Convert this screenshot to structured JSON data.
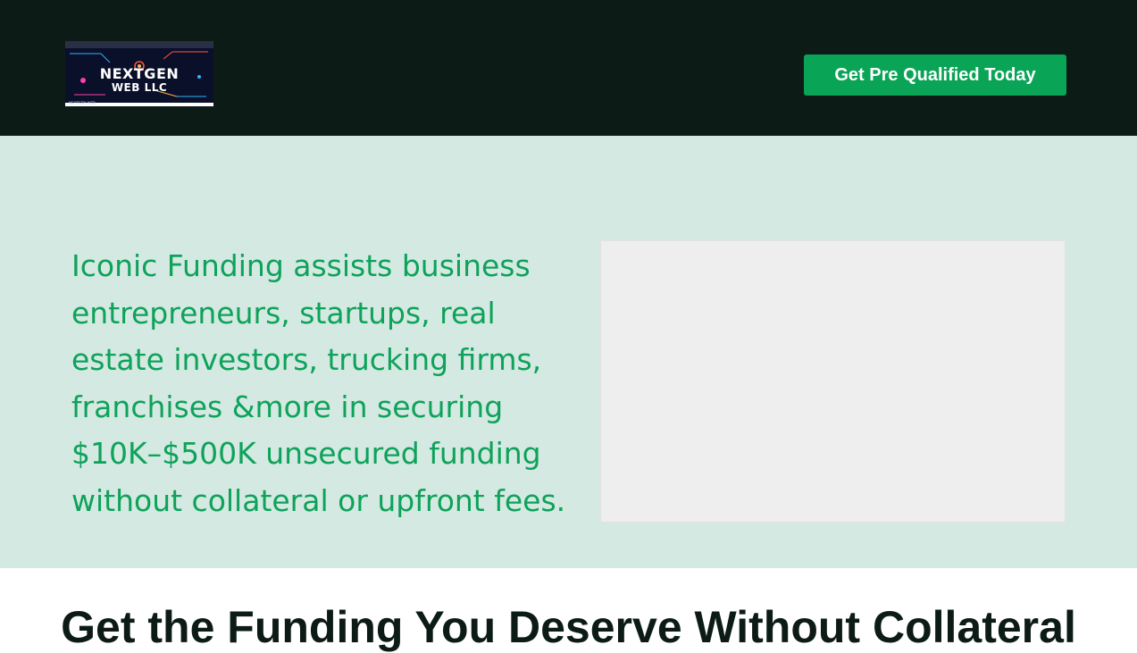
{
  "header": {
    "logo": {
      "line1": "NEXTGEN",
      "line2": "WEB LLC",
      "tagline": "NEXTGEN WEB"
    },
    "cta_label": "Get Pre Qualified Today"
  },
  "hero": {
    "text": "Iconic Funding assists business entrepreneurs, startups, real estate investors, trucking firms, franchises  &more in securing $10K–$500K unsecured funding without collateral or upfront fees."
  },
  "section": {
    "title": "Get the Funding You Deserve Without Collateral"
  },
  "colors": {
    "header_bg": "#0d1b17",
    "cta_bg": "#09a456",
    "hero_bg": "#d4e9e2",
    "hero_text": "#0ea25a",
    "media_bg": "#eeeeee"
  }
}
